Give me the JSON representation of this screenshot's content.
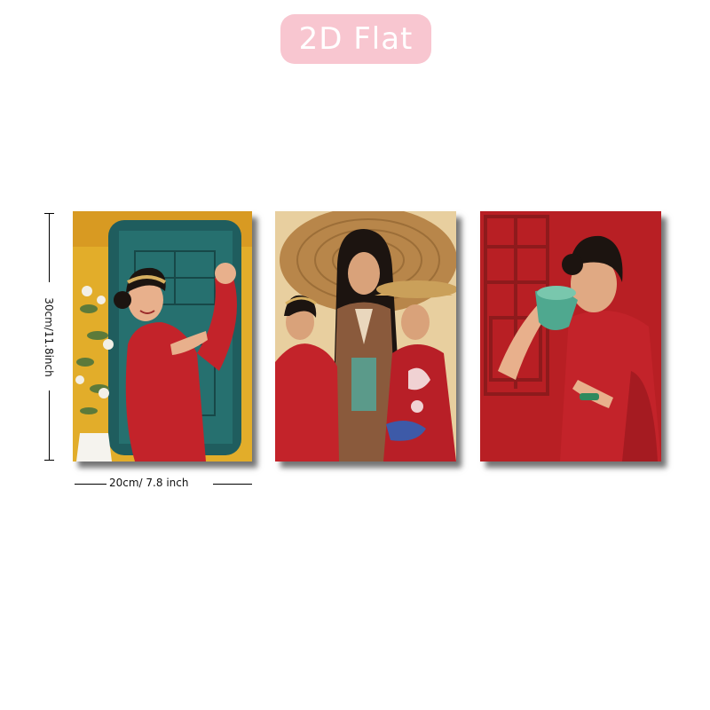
{
  "badge": {
    "label": "2D Flat",
    "color": "#f8c6d0"
  },
  "dimensions": {
    "height_label": "30cm/11.8inch",
    "width_label": "20cm/ 7.8 inch"
  },
  "panels": [
    {
      "subject": "woman-in-red-dress-flexing"
    },
    {
      "subject": "three-women-with-conical-hats"
    },
    {
      "subject": "woman-drinking-from-teacup"
    }
  ],
  "colors": {
    "red": "#c3232a",
    "mustard": "#e2ad2a",
    "teal": "#1f5d5e",
    "dark_red": "#8e1a1c"
  }
}
